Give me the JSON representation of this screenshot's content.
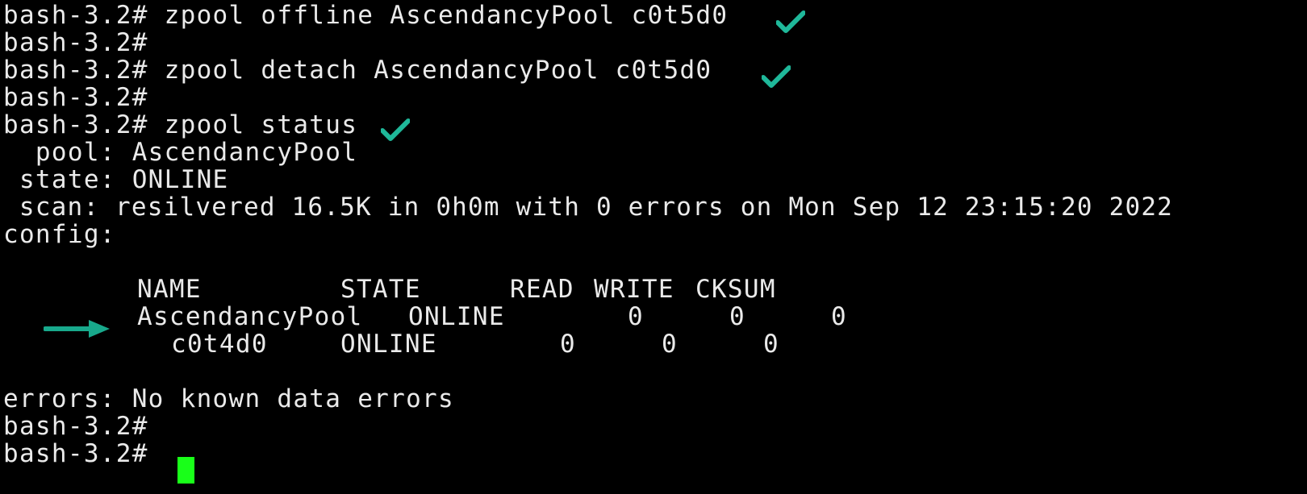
{
  "terminal": {
    "prompt": "bash-3.2#",
    "colors": {
      "background": "#000000",
      "text": "#eaeaea",
      "check_mark": "#1fb89a",
      "arrow": "#18a98c",
      "cursor": "#19ff19"
    },
    "commands": {
      "offline": "bash-3.2# zpool offline AscendancyPool c0t5d0",
      "detach": "bash-3.2# zpool detach AscendancyPool c0t5d0",
      "status": "bash-3.2# zpool status"
    },
    "status": {
      "pool_line": "  pool: AscendancyPool",
      "state_line": " state: ONLINE",
      "scan_line": " scan: resilvered 16.5K in 0h0m with 0 errors on Mon Sep 12 23:15:20 2022",
      "config_line": "config:",
      "errors_line": "errors: No known data errors"
    },
    "config_table": {
      "headers": {
        "name": "NAME",
        "state": "STATE",
        "read": "READ",
        "write": "WRITE",
        "cksum": "CKSUM"
      },
      "rows": [
        {
          "name": "AscendancyPool",
          "state": "ONLINE",
          "read": "0",
          "write": "0",
          "cksum": "0"
        },
        {
          "name": "c0t4d0",
          "state": "ONLINE",
          "read": "0",
          "write": "0",
          "cksum": "0"
        }
      ]
    },
    "annotations": {
      "check_icon": "check-mark-icon",
      "arrow_icon": "right-arrow-icon"
    }
  }
}
